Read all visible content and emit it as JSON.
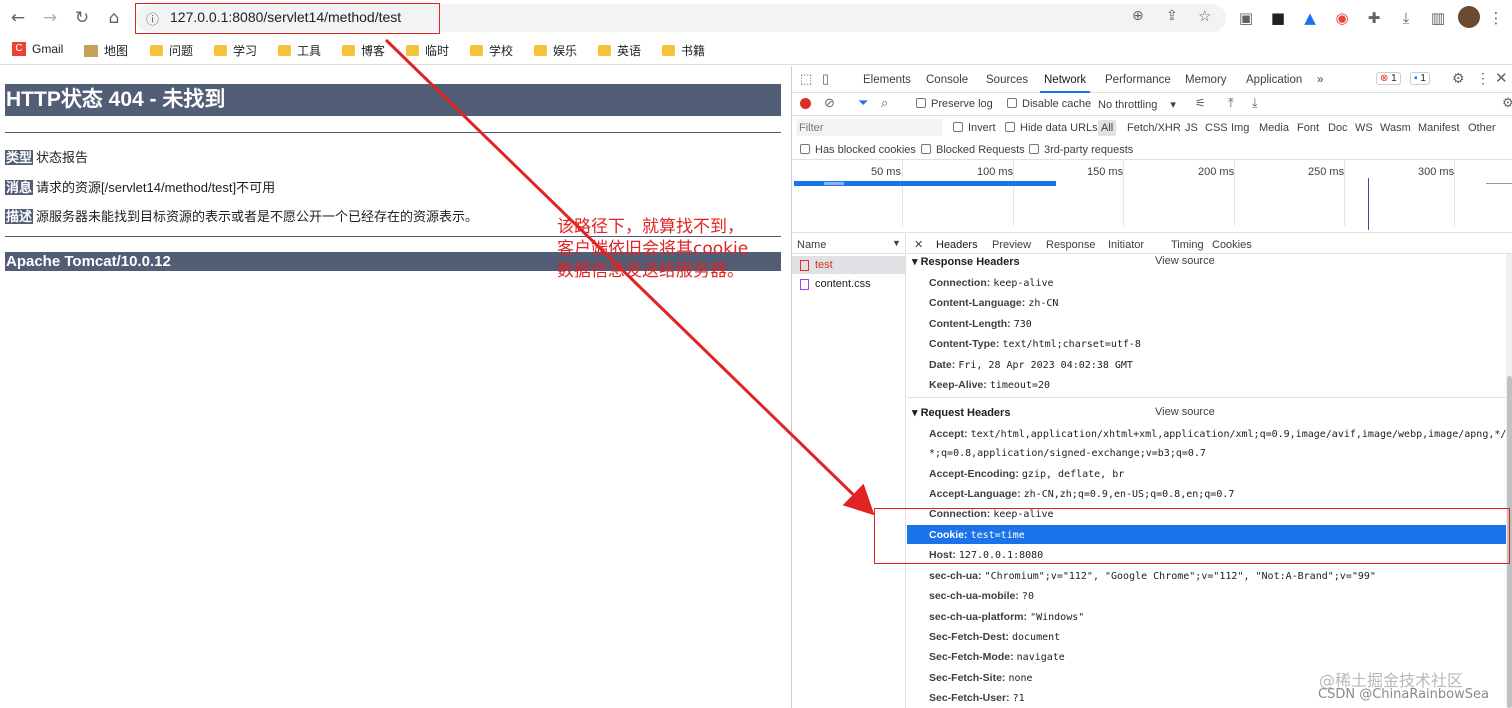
{
  "browser": {
    "url": "127.0.0.1:8080/servlet14/method/test",
    "bookmarks": [
      "Gmail",
      "地图",
      "问题",
      "学习",
      "工具",
      "博客",
      "临时",
      "学校",
      "娱乐",
      "英语",
      "书籍"
    ]
  },
  "page": {
    "title": "HTTP状态 404 - 未找到",
    "rows": [
      {
        "tag": "类型",
        "text": "状态报告"
      },
      {
        "tag": "消息",
        "text": "请求的资源[/servlet14/method/test]不可用"
      },
      {
        "tag": "描述",
        "text": "源服务器未能找到目标资源的表示或者是不愿公开一个已经存在的资源表示。"
      }
    ],
    "server": "Apache Tomcat/10.0.12",
    "annotation": "该路径下，就算找不到，客户端依旧会将其cookie 数据信息发送给服务器。"
  },
  "devtools": {
    "tabs": [
      "Elements",
      "Console",
      "Sources",
      "Network",
      "Performance",
      "Memory",
      "Application"
    ],
    "more": "»",
    "error_count": "1",
    "message_count": "1",
    "preserve_log": "Preserve log",
    "disable_cache": "Disable cache",
    "throttling": "No throttling",
    "filter_placeholder": "Filter",
    "invert": "Invert",
    "hide_data_urls": "Hide data URLs",
    "filter_types": [
      "All",
      "Fetch/XHR",
      "JS",
      "CSS",
      "Img",
      "Media",
      "Font",
      "Doc",
      "WS",
      "Wasm",
      "Manifest",
      "Other"
    ],
    "blocked_cookies": "Has blocked cookies",
    "blocked_requests": "Blocked Requests",
    "third_party": "3rd-party requests",
    "timeline_ticks": [
      "50 ms",
      "100 ms",
      "150 ms",
      "200 ms",
      "250 ms",
      "300 ms"
    ],
    "name_header": "Name",
    "requests": [
      "test",
      "content.css"
    ],
    "detail_tabs": [
      "Headers",
      "Preview",
      "Response",
      "Initiator",
      "Timing",
      "Cookies"
    ],
    "view_source": "View source",
    "response_headers_title": "Response Headers",
    "response_headers": [
      {
        "key": "Connection:",
        "value": "keep-alive"
      },
      {
        "key": "Content-Language:",
        "value": "zh-CN"
      },
      {
        "key": "Content-Length:",
        "value": "730"
      },
      {
        "key": "Content-Type:",
        "value": "text/html;charset=utf-8"
      },
      {
        "key": "Date:",
        "value": "Fri, 28 Apr 2023 04:02:38 GMT"
      },
      {
        "key": "Keep-Alive:",
        "value": "timeout=20"
      }
    ],
    "request_headers_title": "Request Headers",
    "request_headers": [
      {
        "key": "Accept:",
        "value": "text/html,application/xhtml+xml,application/xml;q=0.9,image/avif,image/webp,image/apng,*/"
      },
      {
        "key": "",
        "value": "*;q=0.8,application/signed-exchange;v=b3;q=0.7"
      },
      {
        "key": "Accept-Encoding:",
        "value": "gzip, deflate, br"
      },
      {
        "key": "Accept-Language:",
        "value": "zh-CN,zh;q=0.9,en-US;q=0.8,en;q=0.7"
      },
      {
        "key": "Connection:",
        "value": "keep-alive"
      },
      {
        "key": "Cookie:",
        "value": "test=time"
      },
      {
        "key": "Host:",
        "value": "127.0.0.1:8080"
      },
      {
        "key": "sec-ch-ua:",
        "value": "\"Chromium\";v=\"112\", \"Google Chrome\";v=\"112\", \"Not:A-Brand\";v=\"99\""
      },
      {
        "key": "sec-ch-ua-mobile:",
        "value": "?0"
      },
      {
        "key": "sec-ch-ua-platform:",
        "value": "\"Windows\""
      },
      {
        "key": "Sec-Fetch-Dest:",
        "value": "document"
      },
      {
        "key": "Sec-Fetch-Mode:",
        "value": "navigate"
      },
      {
        "key": "Sec-Fetch-Site:",
        "value": "none"
      },
      {
        "key": "Sec-Fetch-User:",
        "value": "?1"
      }
    ]
  },
  "watermark": {
    "line1": "@稀土掘金技术社区",
    "line2": "CSDN @ChinaRainbowSea"
  },
  "colors": {
    "tomcat_bar": "#525d76",
    "annotation_red": "#e02424",
    "selection_blue": "#1a73e8"
  }
}
